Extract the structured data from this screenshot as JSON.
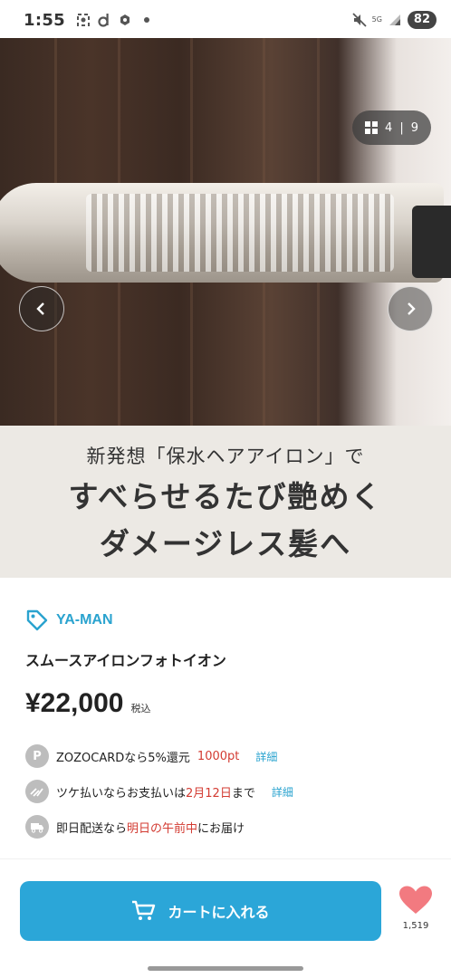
{
  "status_bar": {
    "time": "1:55",
    "network": "5G",
    "battery": "82"
  },
  "gallery": {
    "current": "4",
    "separator": "|",
    "total": "9"
  },
  "banner": {
    "line1": "新発想「保水ヘアアイロン」で",
    "line2": "すべらせるたび艶めく",
    "line3": "ダメージレス髪へ"
  },
  "product": {
    "brand": "YA-MAN",
    "name": "スムースアイロンフォトイオン",
    "price": "¥22,000",
    "tax_label": "税込"
  },
  "perks": {
    "zozocard": {
      "icon_letter": "P",
      "text": "ZOZOCARDなら5%還元",
      "points": "1000pt",
      "link": "詳細"
    },
    "tsuke": {
      "text_before": "ツケ払いならお支払いは",
      "date": "2月12日",
      "text_after": "まで",
      "link": "詳細"
    },
    "delivery": {
      "text_before": "即日配送なら",
      "highlight": "明日の午前中",
      "text_after": "にお届け"
    }
  },
  "actions": {
    "cart_label": "カートに入れる",
    "favorite_count": "1,519"
  },
  "colors": {
    "accent": "#2ba6d8",
    "brand": "#2aa3cf",
    "highlight_red": "#d33b32",
    "heart": "#f27a80"
  }
}
